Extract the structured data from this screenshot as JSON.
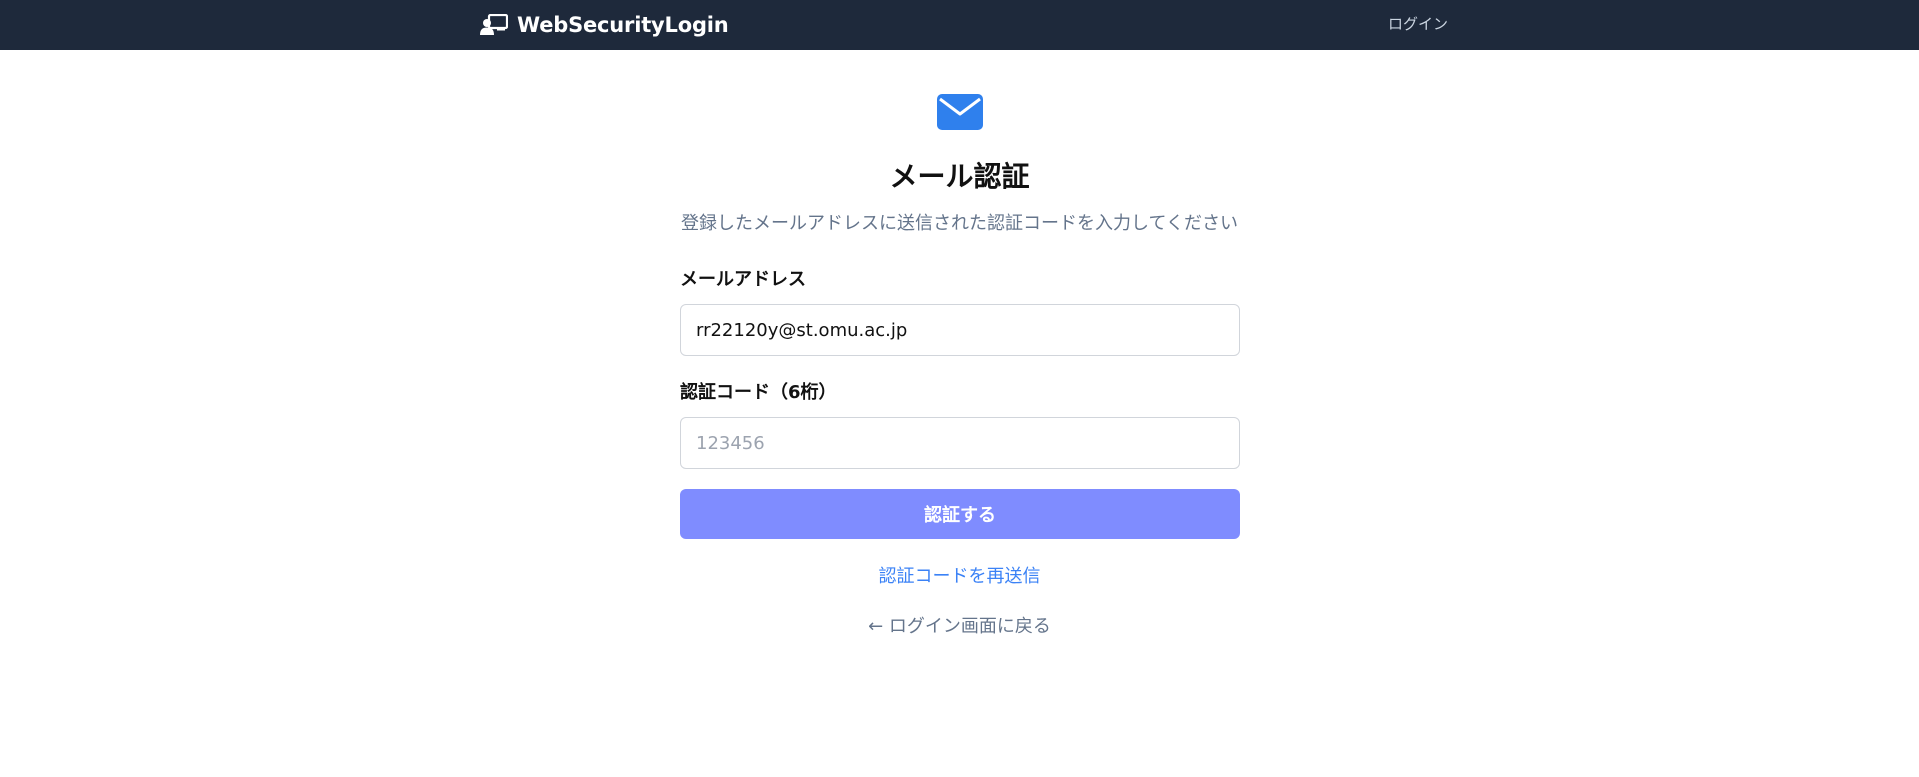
{
  "navbar": {
    "brand_name": "WebSecurityLogin",
    "brand_icon": "user-screen-icon",
    "login_link": "ログイン"
  },
  "page": {
    "icon": "envelope-icon",
    "title": "メール認証",
    "subtitle": "登録したメールアドレスに送信された認証コードを入力してください"
  },
  "form": {
    "email_label": "メールアドレス",
    "email_value": "rr22120y@st.omu.ac.jp",
    "code_label": "認証コード（6桁）",
    "code_placeholder": "123456",
    "submit_label": "認証する"
  },
  "links": {
    "resend": "認証コードを再送信",
    "back": "← ログイン画面に戻る"
  },
  "colors": {
    "navbar_bg": "#1e293b",
    "accent": "#7f8cff",
    "link": "#3b82f6",
    "icon": "#2f80ed"
  }
}
